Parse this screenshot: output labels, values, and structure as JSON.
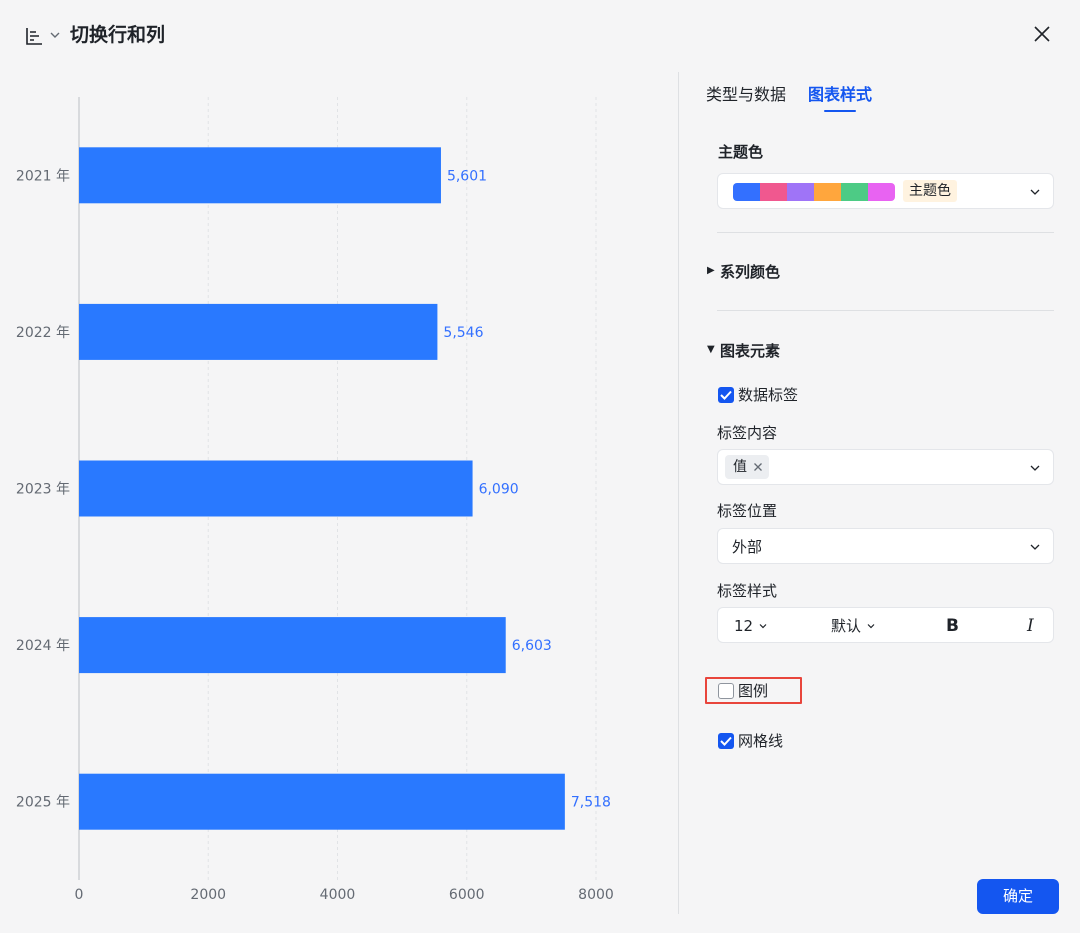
{
  "header": {
    "title": "切换行和列",
    "icon": "bar-chart-icon"
  },
  "tabs": [
    {
      "label": "类型与数据",
      "active": false
    },
    {
      "label": "图表样式",
      "active": true
    }
  ],
  "panel": {
    "theme": {
      "label": "主题色",
      "value": "主题色",
      "swatches": [
        "#3370ff",
        "#f0588f",
        "#9f74f7",
        "#ffa63d",
        "#4dcb85",
        "#e863f2"
      ]
    },
    "series_color": {
      "label": "系列颜色",
      "expanded": false
    },
    "chart_elements": {
      "label": "图表元素",
      "expanded": true,
      "data_labels": {
        "label": "数据标签",
        "checked": true
      },
      "label_content": {
        "label": "标签内容",
        "tag": "值"
      },
      "label_position": {
        "label": "标签位置",
        "value": "外部"
      },
      "label_style": {
        "label": "标签样式",
        "size": "12",
        "font": "默认",
        "bold": "B",
        "italic": "I"
      },
      "legend": {
        "label": "图例",
        "checked": false
      },
      "gridlines": {
        "label": "网格线",
        "checked": true
      }
    }
  },
  "confirm_label": "确定",
  "colors": {
    "accent": "#1456f0",
    "bar": "#2979ff",
    "highlight": "#e8453c"
  },
  "chart_data": {
    "type": "bar",
    "orientation": "horizontal",
    "categories": [
      "2021 年",
      "2022 年",
      "2023 年",
      "2024 年",
      "2025 年"
    ],
    "values": [
      5601,
      5546,
      6090,
      6603,
      7518
    ],
    "value_labels": [
      "5,601",
      "5,546",
      "6,090",
      "6,603",
      "7,518"
    ],
    "x_ticks": [
      0,
      2000,
      4000,
      6000,
      8000
    ],
    "xlim": [
      0,
      8000
    ],
    "grid": true,
    "legend": false
  }
}
